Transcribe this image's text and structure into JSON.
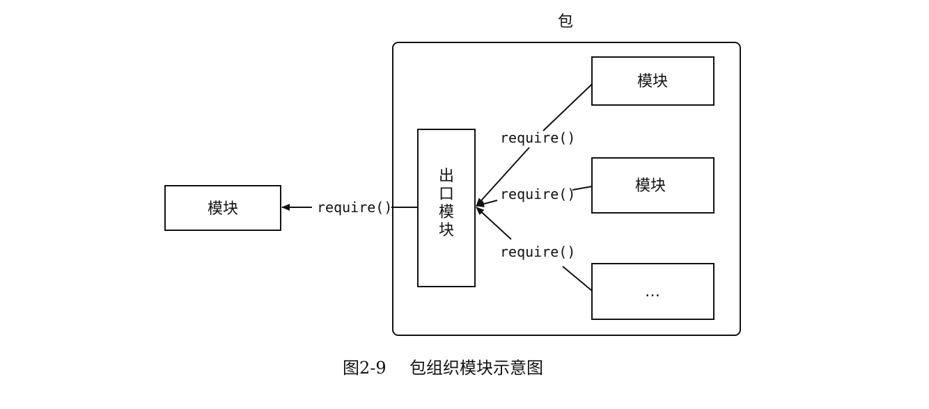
{
  "package": {
    "title": "包"
  },
  "exit_module": {
    "chars": [
      "出",
      "口",
      "模",
      "块"
    ]
  },
  "external_module": {
    "label": "模块"
  },
  "inner_modules": [
    {
      "label": "模块"
    },
    {
      "label": "模块"
    },
    {
      "label": "…"
    }
  ],
  "edges": {
    "external": {
      "label": "require()"
    },
    "inner": [
      {
        "label": "require()"
      },
      {
        "label": "require()"
      },
      {
        "label": "require()"
      }
    ]
  },
  "caption": {
    "number": "图2-9",
    "title": "包组织模块示意图"
  }
}
